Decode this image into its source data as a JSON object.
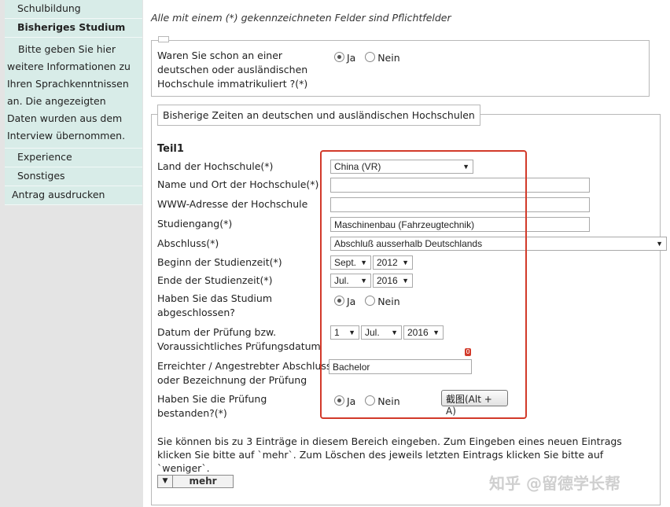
{
  "sidebar": {
    "items": [
      {
        "label": "Schulbildung"
      },
      {
        "label": "Bisheriges Studium"
      }
    ],
    "description": "Bitte geben Sie hier weitere Informationen zu Ihren Sprachkenntnissen an. Die angezeigten Daten wurden aus dem Interview übernommen.",
    "items_after": [
      {
        "label": "Experience"
      },
      {
        "label": "Sonstiges"
      }
    ],
    "print_label": "Antrag ausdrucken"
  },
  "main": {
    "required_note": "Alle mit einem (*) gekennzeichneten Felder sind Pflichtfelder",
    "q_enrolled": {
      "label": "Waren Sie schon an einer deutschen oder ausländischen Hochschule immatrikuliert ?(*)",
      "yes": "Ja",
      "no": "Nein",
      "selected": "Ja"
    },
    "section_legend": "Bisherige Zeiten an deutschen und ausländischen Hochschulen",
    "part_title": "Teil1",
    "fields": {
      "country": {
        "label": "Land der Hochschule(*)",
        "value": "China (VR)"
      },
      "name": {
        "label": "Name und Ort der Hochschule(*)",
        "value": ""
      },
      "www": {
        "label": "WWW-Adresse der Hochschule",
        "value": ""
      },
      "course": {
        "label": "Studiengang(*)",
        "value": "Maschinenbau (Fahrzeugtechnik)"
      },
      "degree": {
        "label": "Abschluss(*)",
        "value": "Abschluß ausserhalb Deutschlands"
      },
      "start": {
        "label": "Beginn der Studienzeit(*)",
        "month": "Sept.",
        "year": "2012"
      },
      "end": {
        "label": "Ende der Studienzeit(*)",
        "month": "Jul.",
        "year": "2016"
      },
      "completed": {
        "label": "Haben Sie das Studium abgeschlossen?",
        "yes": "Ja",
        "no": "Nein",
        "selected": "Ja"
      },
      "exam_date": {
        "label": "Datum der Prüfung bzw. Voraussichtliches Prüfungsdatum",
        "day": "1",
        "month": "Jul.",
        "year": "2016"
      },
      "achieved": {
        "label": "Erreichter / Angestrebter Abschluss oder Bezeichnung der Prüfung",
        "value": "Bachelor"
      },
      "passed": {
        "label": "Haben Sie die Prüfung bestanden?(*)",
        "yes": "Ja",
        "no": "Nein",
        "selected": "Ja"
      }
    },
    "screenshot_button": "截图(Alt + A)",
    "badge": "0",
    "info_text": "Sie können bis zu 3 Einträge in diesem Bereich eingeben. Zum Eingeben eines neuen Eintrags klicken Sie bitte auf `mehr`. Zum Löschen des jeweils letzten Eintrags klicken Sie bitte auf `weniger`.",
    "more_button": "mehr"
  },
  "watermark": "知乎 @留德学长帮",
  "colors": {
    "sidebar_bg": "#d8ece8",
    "highlight": "#d23a2a"
  },
  "icons": [
    "chevron-down-icon",
    "radio-icon"
  ]
}
